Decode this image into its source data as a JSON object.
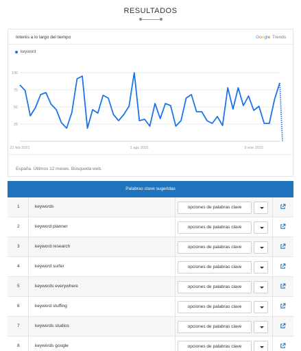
{
  "header": {
    "title": "RESULTADOS"
  },
  "trends_card": {
    "title": "Interés a lo largo del tiempo",
    "logo_google": "Google",
    "logo_trends": "Trends",
    "legend_label": "keyword",
    "footnote": "España. Últimos 12 meses. Búsqueda web."
  },
  "chart_data": {
    "type": "line",
    "series": [
      {
        "name": "keyword",
        "color": "#1a73e8",
        "values": [
          82,
          74,
          37,
          49,
          68,
          71,
          54,
          46,
          27,
          19,
          42,
          91,
          95,
          19,
          46,
          41,
          67,
          63,
          39,
          30,
          39,
          51,
          100,
          30,
          32,
          22,
          55,
          33,
          55,
          52,
          22,
          30,
          63,
          68,
          43,
          43,
          30,
          26,
          36,
          23,
          78,
          47,
          78,
          52,
          66,
          45,
          51,
          26,
          26,
          61,
          85
        ]
      }
    ],
    "partial_tail": 0,
    "x_tick_labels": [
      "21 feb 2021",
      "1 ago 2021",
      "9 ene 2022"
    ],
    "x_tick_index": [
      0,
      23,
      45
    ],
    "y_ticks": [
      25,
      50,
      75,
      100
    ],
    "ylim": [
      0,
      100
    ],
    "grid": true
  },
  "keywords_table": {
    "header": "Palabras clave sugeridas",
    "option_label": "opciones de palabras clave",
    "rows": [
      {
        "num": "1",
        "keyword": "keywords"
      },
      {
        "num": "2",
        "keyword": "keyword planner"
      },
      {
        "num": "3",
        "keyword": "keyword research"
      },
      {
        "num": "4",
        "keyword": "keyword surfer"
      },
      {
        "num": "5",
        "keyword": "keywords everywhere"
      },
      {
        "num": "6",
        "keyword": "keyword stuffing"
      },
      {
        "num": "7",
        "keyword": "keywords studios"
      },
      {
        "num": "8",
        "keyword": "keywords google"
      }
    ]
  },
  "icons": {
    "row_action": "external-link-icon",
    "dropdown": "caret-down-icon"
  },
  "colors": {
    "accent": "#1f74bd",
    "line": "#1a73e8"
  }
}
